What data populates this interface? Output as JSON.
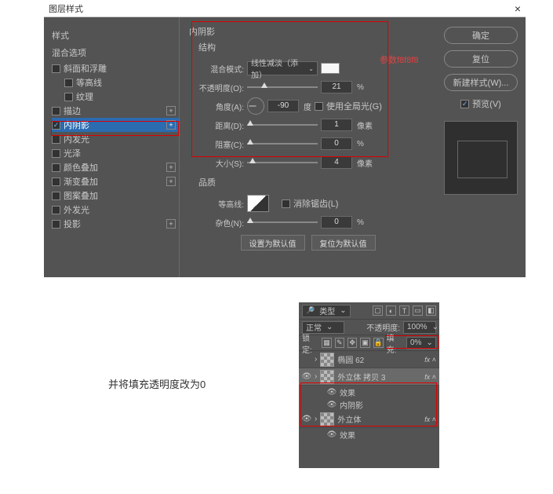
{
  "dialog": {
    "title": "图层样式",
    "close_glyph": "×",
    "left": {
      "style_label": "样式",
      "blend_options": "混合选项",
      "items": [
        {
          "label": "斜面和浮雕",
          "checked": false,
          "plus": false
        },
        {
          "label": "等高线",
          "checked": false,
          "plus": false,
          "sub": true
        },
        {
          "label": "纹理",
          "checked": false,
          "plus": false,
          "sub": true
        },
        {
          "label": "描边",
          "checked": false,
          "plus": true
        },
        {
          "label": "内阴影",
          "checked": true,
          "plus": true,
          "selected": true
        },
        {
          "label": "内发光",
          "checked": false,
          "plus": false
        },
        {
          "label": "光泽",
          "checked": false,
          "plus": false
        },
        {
          "label": "颜色叠加",
          "checked": false,
          "plus": true
        },
        {
          "label": "渐变叠加",
          "checked": false,
          "plus": true
        },
        {
          "label": "图案叠加",
          "checked": false,
          "plus": false
        },
        {
          "label": "外发光",
          "checked": false,
          "plus": false
        },
        {
          "label": "投影",
          "checked": false,
          "plus": true
        }
      ]
    },
    "mid": {
      "title": "内阴影",
      "struct": "结构",
      "blend_mode_lbl": "混合模式:",
      "blend_mode_val": "线性减淡（添加）",
      "opacity_lbl": "不透明度(O):",
      "opacity_val": "21",
      "pct": "%",
      "angle_lbl": "角度(A):",
      "angle_val": "-90",
      "deg": "度",
      "global_light": "使用全局光(G)",
      "distance_lbl": "距离(D):",
      "distance_val": "1",
      "px": "像素",
      "choke_lbl": "阻塞(C):",
      "choke_val": "0",
      "size_lbl": "大小(S):",
      "size_val": "4",
      "quality": "品质",
      "contour_lbl": "等高线:",
      "antialias": "消除锯齿(L)",
      "noise_lbl": "杂色(N):",
      "noise_val": "0",
      "btn_default": "设置为默认值",
      "btn_reset": "复位为默认值",
      "annotation": "参数f8f8f8",
      "swatch_color": "#f8f8f8"
    },
    "right": {
      "ok": "确定",
      "cancel": "复位",
      "new_style": "新建样式(W)...",
      "preview": "预览(V)"
    }
  },
  "layers": {
    "kind_label": "类型",
    "blend_mode": "正常",
    "opacity_lbl": "不透明度:",
    "opacity_val": "100%",
    "lock_lbl": "锁定:",
    "fill_lbl": "填充:",
    "fill_val": "0%",
    "list": [
      {
        "name": "椭圆 62",
        "fx": true,
        "eye": false
      },
      {
        "name": "外立体 拷贝 3",
        "fx": true,
        "selected": true,
        "eye": true,
        "sub": [
          "效果",
          "内阴影"
        ]
      },
      {
        "name": "外立体",
        "fx": true,
        "eye": true,
        "sub": [
          "效果"
        ]
      }
    ]
  },
  "caption": "并将填充透明度改为0"
}
